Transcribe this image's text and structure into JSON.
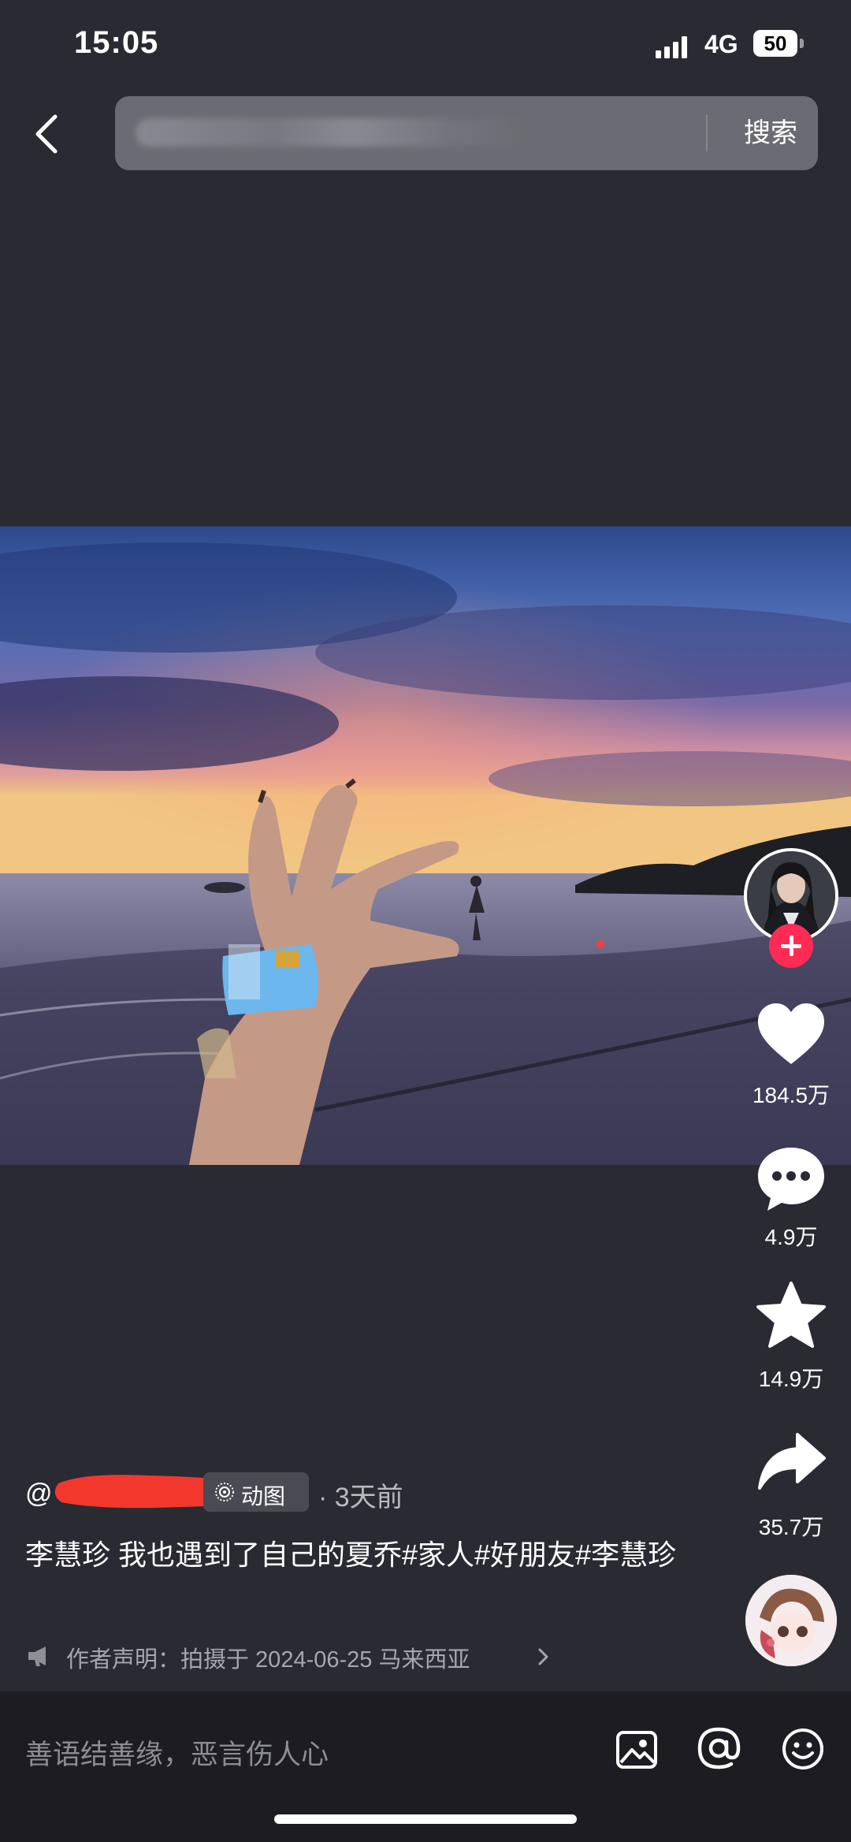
{
  "status_bar": {
    "time": "15:05",
    "network": "4G",
    "battery": "50"
  },
  "header": {
    "search_button": "搜索",
    "search_placeholder": ""
  },
  "engagement": {
    "likes": "184.5万",
    "comments": "4.9万",
    "favorites": "14.9万",
    "shares": "35.7万"
  },
  "post": {
    "author_prefix": "@",
    "tag_label": "动图",
    "time_ago": "· 3天前",
    "caption": "李慧珍 我也遇到了自己的夏乔#家人#好朋友#李慧珍",
    "declaration": "作者声明：拍摄于 2024-06-25 马来西亚"
  },
  "comment_bar": {
    "placeholder": "善语结善缘，恶言伤人心"
  },
  "colors": {
    "background": "#2a2a33",
    "accent": "#fe2c55",
    "bottom_bar": "#1c1c22",
    "search_box": "#6b6b73"
  },
  "icons": [
    "back-arrow-icon",
    "signal-icon",
    "battery-icon",
    "heart-icon",
    "comment-bubble-icon",
    "star-icon",
    "share-arrow-icon",
    "megaphone-icon",
    "image-icon",
    "at-icon",
    "emoji-icon"
  ]
}
